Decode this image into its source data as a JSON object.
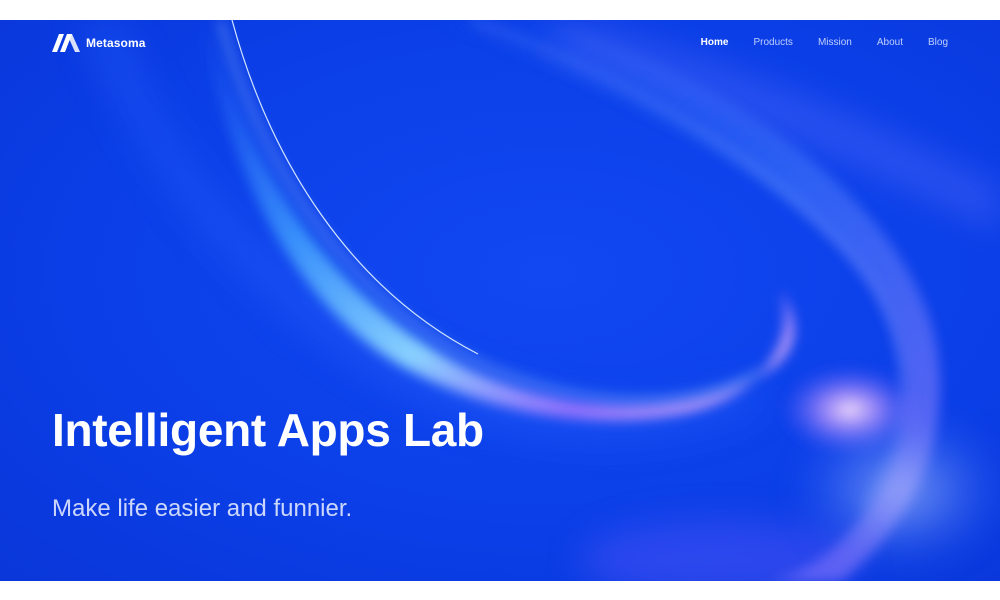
{
  "brand": {
    "name": "Metasoma",
    "logo_icon": "metasoma-logo-icon"
  },
  "nav": {
    "items": [
      {
        "label": "Home",
        "active": true
      },
      {
        "label": "Products",
        "active": false
      },
      {
        "label": "Mission",
        "active": false
      },
      {
        "label": "About",
        "active": false
      },
      {
        "label": "Blog",
        "active": false
      }
    ]
  },
  "hero": {
    "title": "Intelligent Apps Lab",
    "subtitle": "Make life easier and funnier."
  },
  "colors": {
    "hero_background": "#0a3ee8",
    "text_primary": "#ffffff",
    "page_background": "#ffffff"
  }
}
